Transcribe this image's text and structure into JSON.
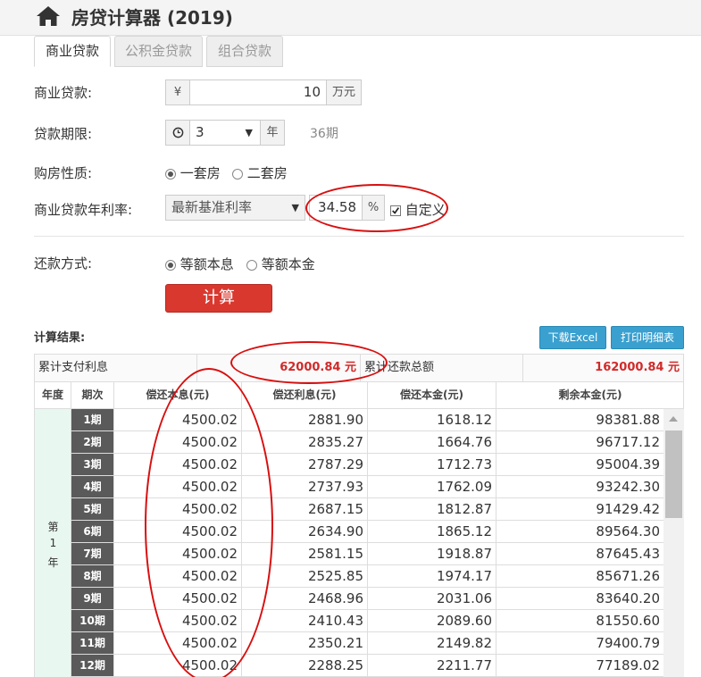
{
  "header": {
    "title": "房贷计算器 (2019)",
    "icon": "home-icon"
  },
  "tabs": [
    {
      "label": "商业贷款",
      "active": true
    },
    {
      "label": "公积金贷款",
      "active": false
    },
    {
      "label": "组合贷款",
      "active": false
    }
  ],
  "form": {
    "loan": {
      "label": "商业贷款:",
      "prefix": "¥",
      "value": "10",
      "unit": "万元"
    },
    "term": {
      "label": "贷款期限:",
      "value": "3",
      "unit": "年",
      "periods": "36期"
    },
    "property": {
      "label": "购房性质:",
      "options": [
        "一套房",
        "二套房"
      ],
      "selected": 0
    },
    "rate": {
      "label": "商业贷款年利率:",
      "select": "最新基准利率",
      "value": "34.58",
      "unit": "%",
      "custom_label": "自定义",
      "custom_checked": true
    },
    "repay": {
      "label": "还款方式:",
      "options": [
        "等额本息",
        "等额本金"
      ],
      "selected": 0
    },
    "submit": "计算"
  },
  "results": {
    "label": "计算结果:",
    "export_button": "下载Excel",
    "print_button": "打印明细表",
    "total_interest_label": "累计支付利息",
    "total_interest_value": "62000.84 元",
    "total_payment_label": "累计还款总额",
    "total_payment_value": "162000.84 元",
    "columns": [
      "年度",
      "期次",
      "偿还本息(元)",
      "偿还利息(元)",
      "偿还本金(元)",
      "剩余本金(元)"
    ],
    "year_label": [
      "第",
      "1",
      "年"
    ],
    "rows": [
      {
        "period": "1期",
        "payment": "4500.02",
        "interest": "2881.90",
        "principal": "1618.12",
        "remaining": "98381.88"
      },
      {
        "period": "2期",
        "payment": "4500.02",
        "interest": "2835.27",
        "principal": "1664.76",
        "remaining": "96717.12"
      },
      {
        "period": "3期",
        "payment": "4500.02",
        "interest": "2787.29",
        "principal": "1712.73",
        "remaining": "95004.39"
      },
      {
        "period": "4期",
        "payment": "4500.02",
        "interest": "2737.93",
        "principal": "1762.09",
        "remaining": "93242.30"
      },
      {
        "period": "5期",
        "payment": "4500.02",
        "interest": "2687.15",
        "principal": "1812.87",
        "remaining": "91429.42"
      },
      {
        "period": "6期",
        "payment": "4500.02",
        "interest": "2634.90",
        "principal": "1865.12",
        "remaining": "89564.30"
      },
      {
        "period": "7期",
        "payment": "4500.02",
        "interest": "2581.15",
        "principal": "1918.87",
        "remaining": "87645.43"
      },
      {
        "period": "8期",
        "payment": "4500.02",
        "interest": "2525.85",
        "principal": "1974.17",
        "remaining": "85671.26"
      },
      {
        "period": "9期",
        "payment": "4500.02",
        "interest": "2468.96",
        "principal": "2031.06",
        "remaining": "83640.20"
      },
      {
        "period": "10期",
        "payment": "4500.02",
        "interest": "2410.43",
        "principal": "2089.60",
        "remaining": "81550.60"
      },
      {
        "period": "11期",
        "payment": "4500.02",
        "interest": "2350.21",
        "principal": "2149.82",
        "remaining": "79400.79"
      },
      {
        "period": "12期",
        "payment": "4500.02",
        "interest": "2288.25",
        "principal": "2211.77",
        "remaining": "77189.02"
      }
    ]
  },
  "colors": {
    "accent_red": "#d9382f",
    "highlight_red": "#d12a2a",
    "button_blue": "#3aa0cf",
    "annotation_red": "#d80f0f"
  }
}
